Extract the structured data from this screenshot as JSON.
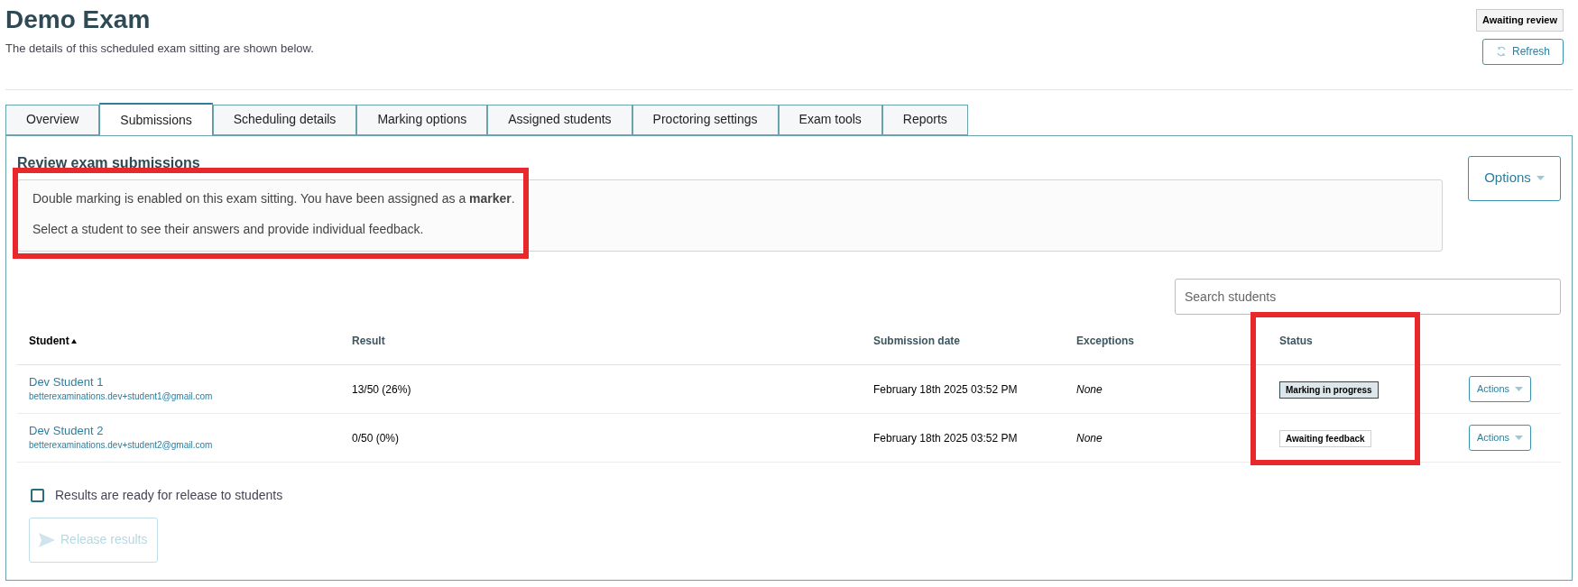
{
  "header": {
    "title": "Demo Exam",
    "subtitle": "The details of this scheduled exam sitting are shown below.",
    "status_badge": "Awaiting review",
    "refresh_button": "Refresh"
  },
  "tabs": [
    {
      "label": "Overview",
      "selected": false
    },
    {
      "label": "Submissions",
      "selected": true
    },
    {
      "label": "Scheduling details",
      "selected": false
    },
    {
      "label": "Marking options",
      "selected": false
    },
    {
      "label": "Assigned students",
      "selected": false
    },
    {
      "label": "Proctoring settings",
      "selected": false
    },
    {
      "label": "Exam tools",
      "selected": false
    },
    {
      "label": "Reports",
      "selected": false
    }
  ],
  "panel": {
    "heading": "Review exam submissions",
    "options_button": "Options",
    "notice": {
      "highlighted": true,
      "lines": [
        "Double marking is enabled on this exam sitting. You have been assigned as a **marker**.",
        "Select a student to see their answers and provide individual feedback."
      ]
    },
    "search": {
      "placeholder": "Search students"
    },
    "table": {
      "status_column_highlighted": true,
      "columns": [
        {
          "label": "Student",
          "sorted": true
        },
        {
          "label": "Result",
          "sorted": false
        },
        {
          "label": "Submission date",
          "sorted": false
        },
        {
          "label": "Exceptions",
          "sorted": false
        },
        {
          "label": "Status",
          "sorted": false
        }
      ],
      "rows": [
        {
          "name": "Dev Student 1",
          "email": "betterexaminations.dev+student1@gmail.com",
          "result": "13/50 (26%)",
          "submission_date": "February 18th 2025 03:52 PM",
          "exceptions": "None",
          "status": {
            "label": "Marking in progress",
            "kind": "active"
          },
          "action": "Actions"
        },
        {
          "name": "Dev Student 2",
          "email": "betterexaminations.dev+student2@gmail.com",
          "result": "0/50 (0%)",
          "submission_date": "February 18th 2025 03:52 PM",
          "exceptions": "None",
          "status": {
            "label": "Awaiting feedback",
            "kind": "pending"
          },
          "action": "Actions"
        }
      ]
    },
    "release_checkbox": {
      "label": "Results are ready for release to students",
      "checked": false
    },
    "release_button": {
      "label": "Release results",
      "disabled": true
    }
  }
}
